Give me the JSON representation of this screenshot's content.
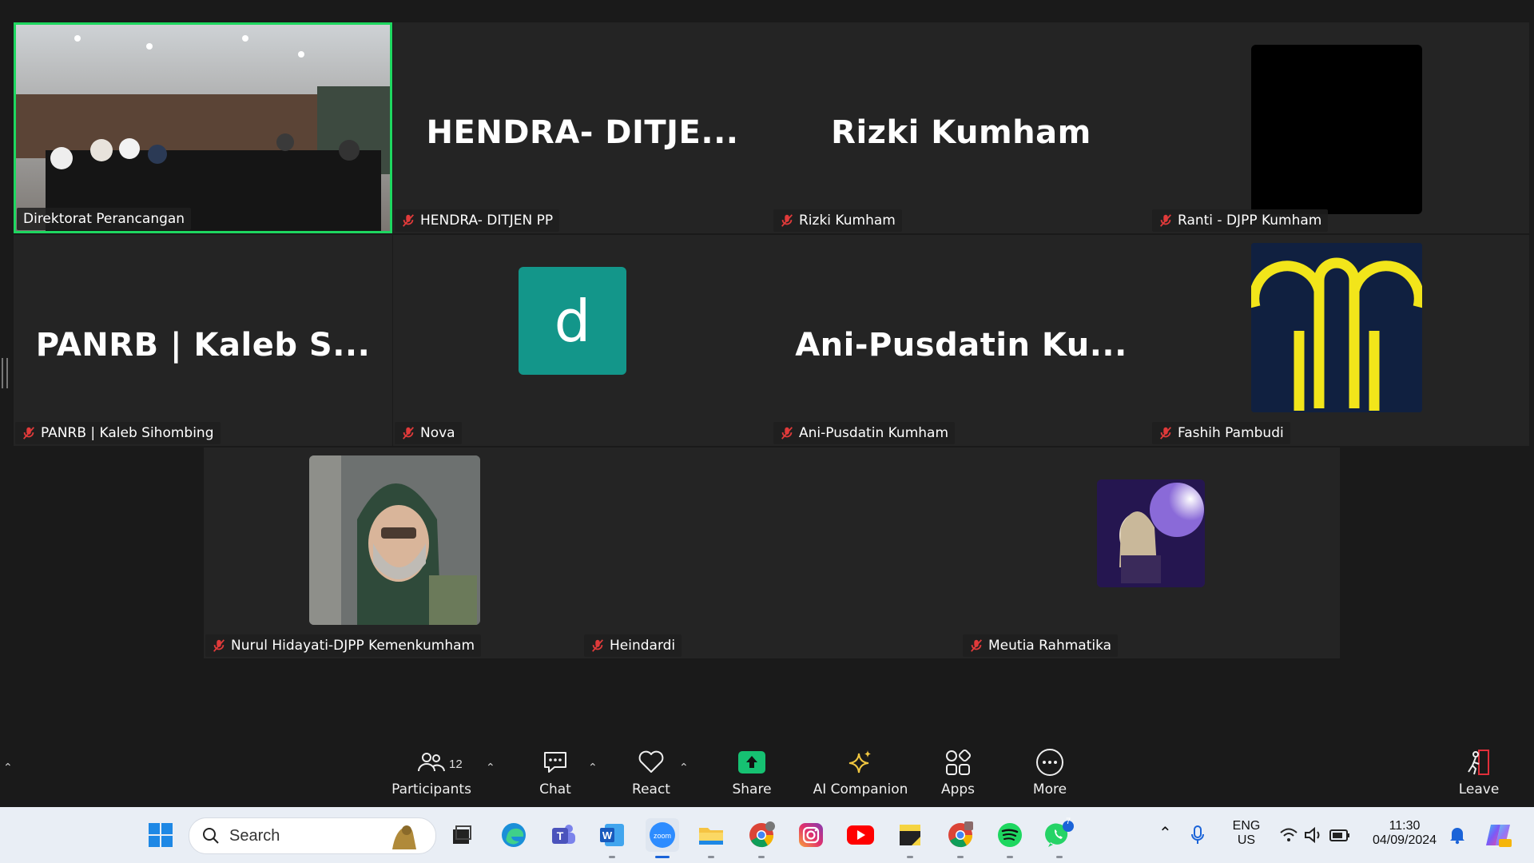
{
  "meeting": {
    "tiles": [
      {
        "id": "t1",
        "label": "Direktorat Perancangan",
        "big_name": "",
        "kind": "camera-room"
      },
      {
        "id": "t2",
        "label": "HENDRA- DITJEN PP",
        "big_name": "HENDRA-  DITJE...",
        "kind": "name"
      },
      {
        "id": "t3",
        "label": "Rizki Kumham",
        "big_name": "Rizki Kumham",
        "kind": "name"
      },
      {
        "id": "t4",
        "label": "Ranti - DJPP Kumham",
        "big_name": "",
        "kind": "black"
      },
      {
        "id": "t5",
        "label": "PANRB | Kaleb Sihombing",
        "big_name": "PANRB | Kaleb S...",
        "kind": "name"
      },
      {
        "id": "t6",
        "label": "Nova",
        "big_name": "",
        "kind": "avatar",
        "avatar_letter": "d",
        "avatar_color": "#13968a"
      },
      {
        "id": "t7",
        "label": "Ani-Pusdatin Kumham",
        "big_name": "Ani-Pusdatin  Ku...",
        "kind": "name"
      },
      {
        "id": "t8",
        "label": "Fashih Pambudi",
        "big_name": "",
        "kind": "logo"
      },
      {
        "id": "t9",
        "label": "Nurul Hidayati-DJPP Kemenkumham",
        "big_name": "",
        "kind": "camera-person"
      },
      {
        "id": "t10",
        "label": "Heindardi",
        "big_name": "",
        "kind": "empty"
      },
      {
        "id": "t11",
        "label": "Meutia Rahmatika",
        "big_name": "",
        "kind": "anime"
      }
    ],
    "active_speaker_color": "#1ed760"
  },
  "toolbar": {
    "participants_label": "Participants",
    "participants_count": "12",
    "chat_label": "Chat",
    "react_label": "React",
    "share_label": "Share",
    "ai_label": "AI Companion",
    "apps_label": "Apps",
    "more_label": "More",
    "leave_label": "Leave",
    "share_color": "#16c172",
    "leave_color": "#e02f3a"
  },
  "taskbar": {
    "search_placeholder": "Search",
    "lang_top": "ENG",
    "lang_bottom": "US",
    "time": "11:30",
    "date": "04/09/2024",
    "chrome_badge": "",
    "whatsapp_badge": "7",
    "apps": [
      "windows-start",
      "search",
      "file-view",
      "edge",
      "teams",
      "word",
      "zoom",
      "file-explorer",
      "chrome",
      "instagram",
      "youtube",
      "sticky-notes",
      "chrome-profile",
      "spotify",
      "whatsapp"
    ]
  }
}
